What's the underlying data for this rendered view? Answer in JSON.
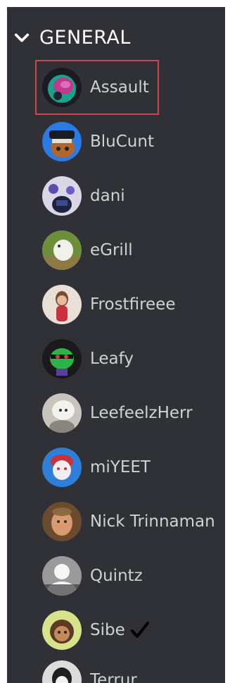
{
  "channel": {
    "title": "GENERAL"
  },
  "members": [
    {
      "name": "Assault"
    },
    {
      "name": "BluCunt"
    },
    {
      "name": "dani"
    },
    {
      "name": "eGrill"
    },
    {
      "name": "Frostfireee"
    },
    {
      "name": "Leafy"
    },
    {
      "name": "LeefeelzHerr"
    },
    {
      "name": "miYEET"
    },
    {
      "name": "Nick Trinnaman"
    },
    {
      "name": "Quintz"
    },
    {
      "name": "Sibe"
    },
    {
      "name": "Terrur"
    }
  ],
  "selected_member": "Assault",
  "checked_member": "Sibe",
  "colors": {
    "panel_bg": "#2f3136",
    "name_text": "#cfd1d5",
    "header_text": "#ffffff",
    "selection_border": "#d9444a"
  },
  "icons": {
    "collapse": "chevron-down-icon",
    "check": "checkmark-icon"
  }
}
